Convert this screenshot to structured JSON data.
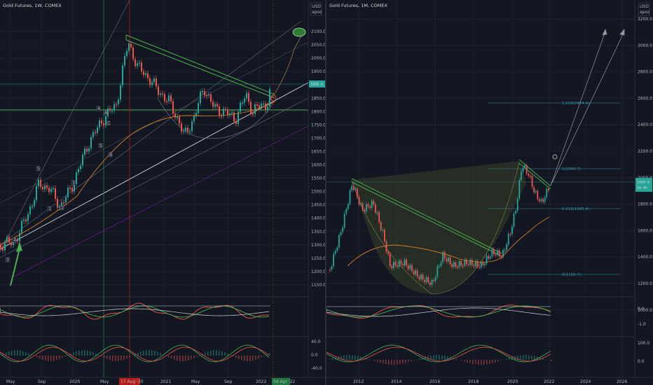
{
  "left": {
    "title": "Gold Futures, 1W, COMEX",
    "currency": "USD",
    "scale_mode": "apoz",
    "price_axis": [
      "2100.0",
      "2050.0",
      "2000.0",
      "1950.0",
      "1900.0",
      "1850.0",
      "1800.0",
      "1750.0",
      "1700.0",
      "1650.0",
      "1600.0",
      "1550.0",
      "1500.0",
      "1450.0",
      "1400.0",
      "1350.0",
      "1300.0",
      "1250.0",
      "1200.0",
      "1150.0"
    ],
    "last_price": "1899.8",
    "time_axis": [
      "May",
      "Sep",
      "2020",
      "May",
      "2021",
      "May",
      "Sep",
      "2022"
    ],
    "crosshair_date": "17 Aug '20",
    "target_date": "04 Apr '22",
    "osc_labels": [
      "40.0",
      "0.0",
      "-40.0"
    ],
    "wave_labels": [
      "3",
      "4",
      "5",
      "1",
      "2",
      "3",
      "4",
      "5",
      "A",
      "B",
      "C"
    ]
  },
  "right": {
    "title": "Gold Futures, 1M, COMEX",
    "currency": "USD",
    "scale_mode": "apoz",
    "price_axis": [
      "3200.0",
      "3000.0",
      "2800.0",
      "2600.0",
      "2400.0",
      "2200.0",
      "2000.0",
      "1800.0",
      "1600.0",
      "1400.0",
      "1200.0",
      "1000.0"
    ],
    "last_price": "1899.8",
    "countdown": "5d 4h",
    "time_axis": [
      "2012",
      "2014",
      "2016",
      "2018",
      "2020",
      "2022",
      "2024",
      "2026"
    ],
    "fib_labels": [
      "1.618(2474.4)",
      "1(2089.7)",
      "0.618(1685.4)",
      "0(1180.7)"
    ],
    "osc1_labels": [
      "0.0",
      "-1.0"
    ],
    "osc2_labels": [
      "100.0",
      "0.0"
    ]
  },
  "colors": {
    "background": "#131722",
    "up_candle": "#26a69a",
    "down_candle": "#ef5350",
    "trendline": "#4caf50",
    "moving_average": "#d27a2c",
    "crosshair_green": "#1e7a3c",
    "crosshair_red": "#b71c1c"
  }
}
